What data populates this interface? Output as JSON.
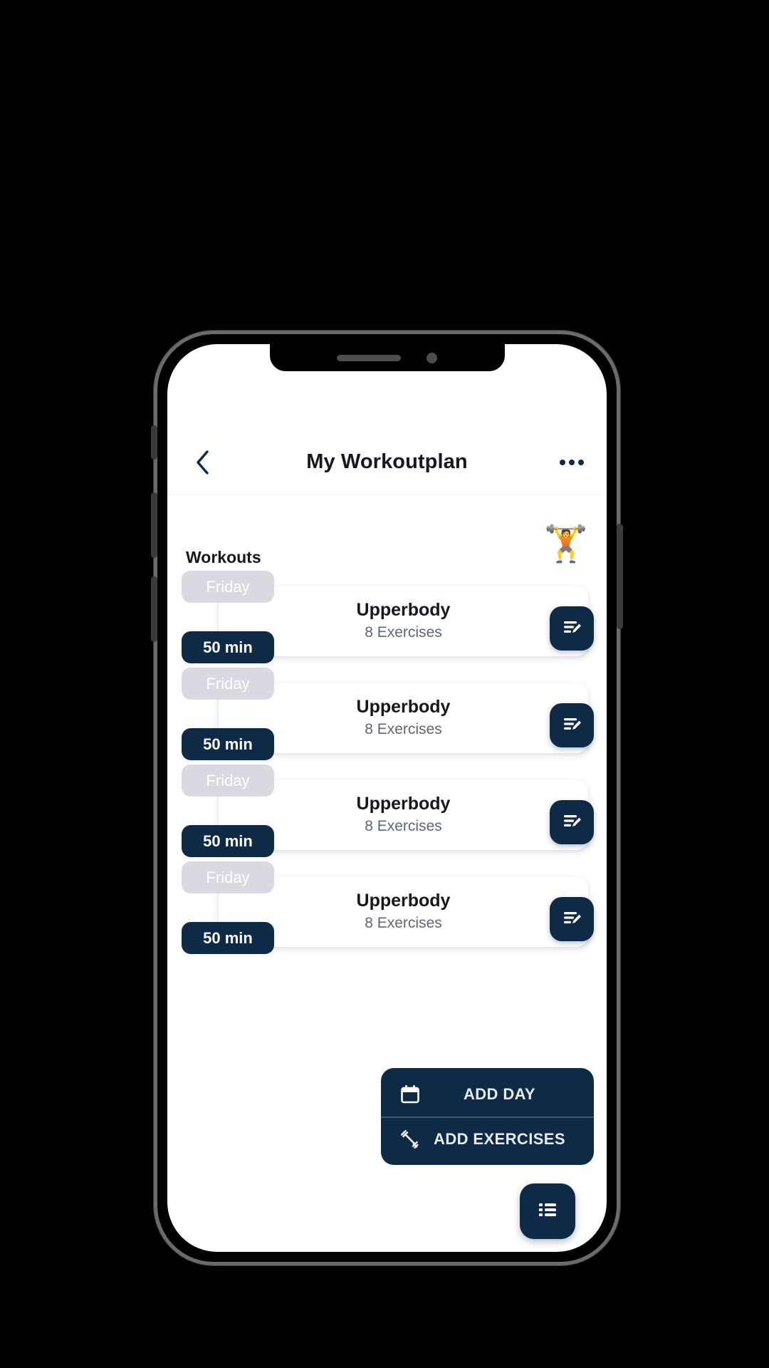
{
  "device": {
    "notch": {
      "speaker": "speaker-grill",
      "camera": "front-camera"
    },
    "buttons": [
      "silent-switch",
      "volume-up",
      "volume-down",
      "power"
    ]
  },
  "header": {
    "back_icon": "chevron-left-icon",
    "title": "My Workoutplan",
    "more_icon": "more-horizontal-icon"
  },
  "section": {
    "label": "Workouts",
    "emoji": "🏋️",
    "emoji_name": "weight-lifter-emoji"
  },
  "workouts": [
    {
      "day": "Friday",
      "duration": "50 min",
      "name": "Upperbody",
      "exercises": "8 Exercises",
      "edit_icon": "edit-note-icon"
    },
    {
      "day": "Friday",
      "duration": "50 min",
      "name": "Upperbody",
      "exercises": "8 Exercises",
      "edit_icon": "edit-note-icon"
    },
    {
      "day": "Friday",
      "duration": "50 min",
      "name": "Upperbody",
      "exercises": "8 Exercises",
      "edit_icon": "edit-note-icon"
    },
    {
      "day": "Friday",
      "duration": "50 min",
      "name": "Upperbody",
      "exercises": "8 Exercises",
      "edit_icon": "edit-note-icon"
    }
  ],
  "actions": {
    "add_day": {
      "label": "ADD DAY",
      "icon": "calendar-icon"
    },
    "add_exercises": {
      "label": "ADD EXERCISES",
      "icon": "dumbbell-icon"
    }
  },
  "fab": {
    "icon": "list-icon"
  },
  "colors": {
    "navy": "#0e2a47",
    "pill_gray": "#d9dae1",
    "text_dark": "#15181d",
    "text_muted": "#5d6773",
    "screen_bg": "#ffffff",
    "backdrop": "#000000"
  }
}
